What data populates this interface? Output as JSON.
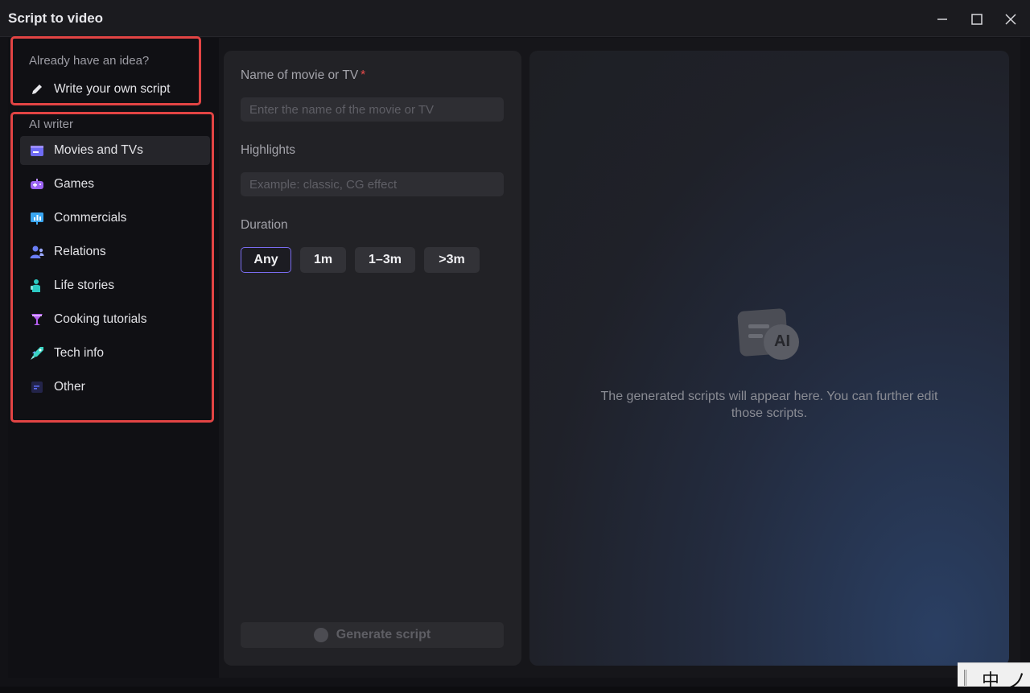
{
  "window": {
    "title": "Script to video"
  },
  "sidebar": {
    "idea_label": "Already have an idea?",
    "write_own": "Write your own script",
    "ai_writer_label": "AI writer",
    "items": [
      {
        "label": "Movies and TVs",
        "icon": "clapperboard-icon",
        "color": "#6f6cf5"
      },
      {
        "label": "Games",
        "icon": "gamepad-icon",
        "color": "#9b63f2"
      },
      {
        "label": "Commercials",
        "icon": "presentation-chart-icon",
        "color": "#3aa7f2"
      },
      {
        "label": "Relations",
        "icon": "people-icon",
        "color": "#6a7ef7"
      },
      {
        "label": "Life stories",
        "icon": "person-icon",
        "color": "#2cc9c3"
      },
      {
        "label": "Cooking tutorials",
        "icon": "cocktail-glass-icon",
        "color": "#b45df0"
      },
      {
        "label": "Tech info",
        "icon": "rocket-icon",
        "color": "#3bd4c4"
      },
      {
        "label": "Other",
        "icon": "document-lines-icon",
        "color": "#5b6bf2"
      }
    ]
  },
  "form": {
    "name_label": "Name of movie or TV",
    "name_required": "*",
    "name_placeholder": "Enter the name of the movie or TV",
    "highlights_label": "Highlights",
    "highlights_placeholder": "Example: classic, CG effect",
    "duration_label": "Duration",
    "durations": [
      "Any",
      "1m",
      "1–3m",
      ">3m"
    ],
    "generate_label": "Generate script"
  },
  "output": {
    "ai_badge": "AI",
    "empty_message": "The generated scripts will appear here. You can further edit those scripts."
  },
  "ime": {
    "text": "中",
    "icon": "ノ"
  },
  "colors": {
    "accent": "#7a6cf0",
    "highlight_box": "#e24444"
  }
}
